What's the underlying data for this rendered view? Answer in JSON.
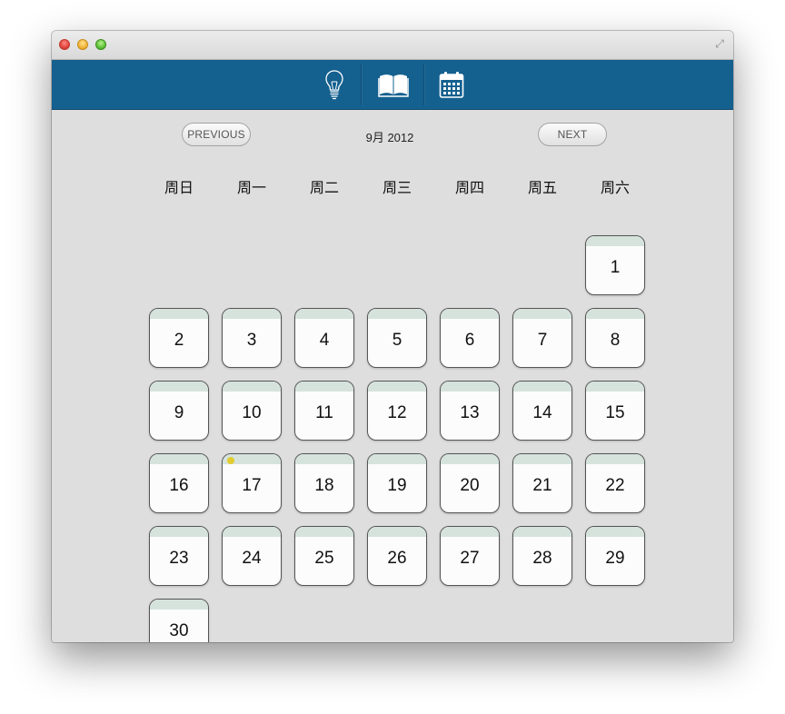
{
  "toolbar": {
    "icons": [
      "lightbulb-icon",
      "book-icon",
      "calendar-icon"
    ],
    "color": "#14608f"
  },
  "nav": {
    "previous_label": "PREVIOUS",
    "next_label": "NEXT",
    "month_label": "9月 2012"
  },
  "weekdays": [
    "周日",
    "周一",
    "周二",
    "周三",
    "周四",
    "周五",
    "周六"
  ],
  "days": [
    {
      "label": "1"
    },
    {
      "label": "2"
    },
    {
      "label": "3"
    },
    {
      "label": "4"
    },
    {
      "label": "5"
    },
    {
      "label": "6"
    },
    {
      "label": "7"
    },
    {
      "label": "8"
    },
    {
      "label": "9"
    },
    {
      "label": "10"
    },
    {
      "label": "11"
    },
    {
      "label": "12"
    },
    {
      "label": "13"
    },
    {
      "label": "14"
    },
    {
      "label": "15"
    },
    {
      "label": "16"
    },
    {
      "label": "17",
      "has_event": true
    },
    {
      "label": "18"
    },
    {
      "label": "19"
    },
    {
      "label": "20"
    },
    {
      "label": "21"
    },
    {
      "label": "22"
    },
    {
      "label": "23"
    },
    {
      "label": "24"
    },
    {
      "label": "25"
    },
    {
      "label": "26"
    },
    {
      "label": "27"
    },
    {
      "label": "28"
    },
    {
      "label": "29"
    },
    {
      "label": "30"
    }
  ],
  "first_weekday_index": 6,
  "colors": {
    "day_header_band": "#d6e3dd",
    "event_dot": "#e2cc30"
  }
}
